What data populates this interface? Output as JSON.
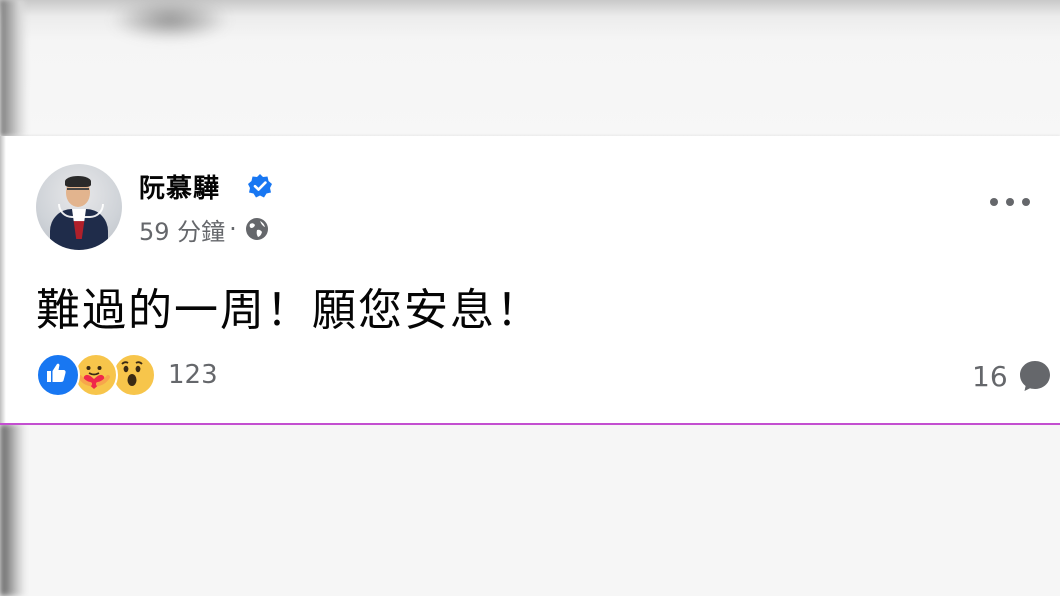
{
  "post": {
    "author": "阮慕驊",
    "timestamp": "59 分鐘",
    "separator": "·",
    "text": "難過的一周！願您安息！",
    "reactions": {
      "types": [
        "like",
        "care",
        "wow"
      ],
      "count": "123"
    },
    "comments": {
      "count": "16"
    }
  },
  "colors": {
    "verified": "#1877f2",
    "like": "#1877f2",
    "muted_text": "#65676b",
    "accent_border": "#c34fd0"
  },
  "icons": [
    "verified-badge-icon",
    "globe-icon",
    "more-options-icon",
    "like-reaction-icon",
    "care-reaction-icon",
    "wow-reaction-icon",
    "comment-icon"
  ]
}
